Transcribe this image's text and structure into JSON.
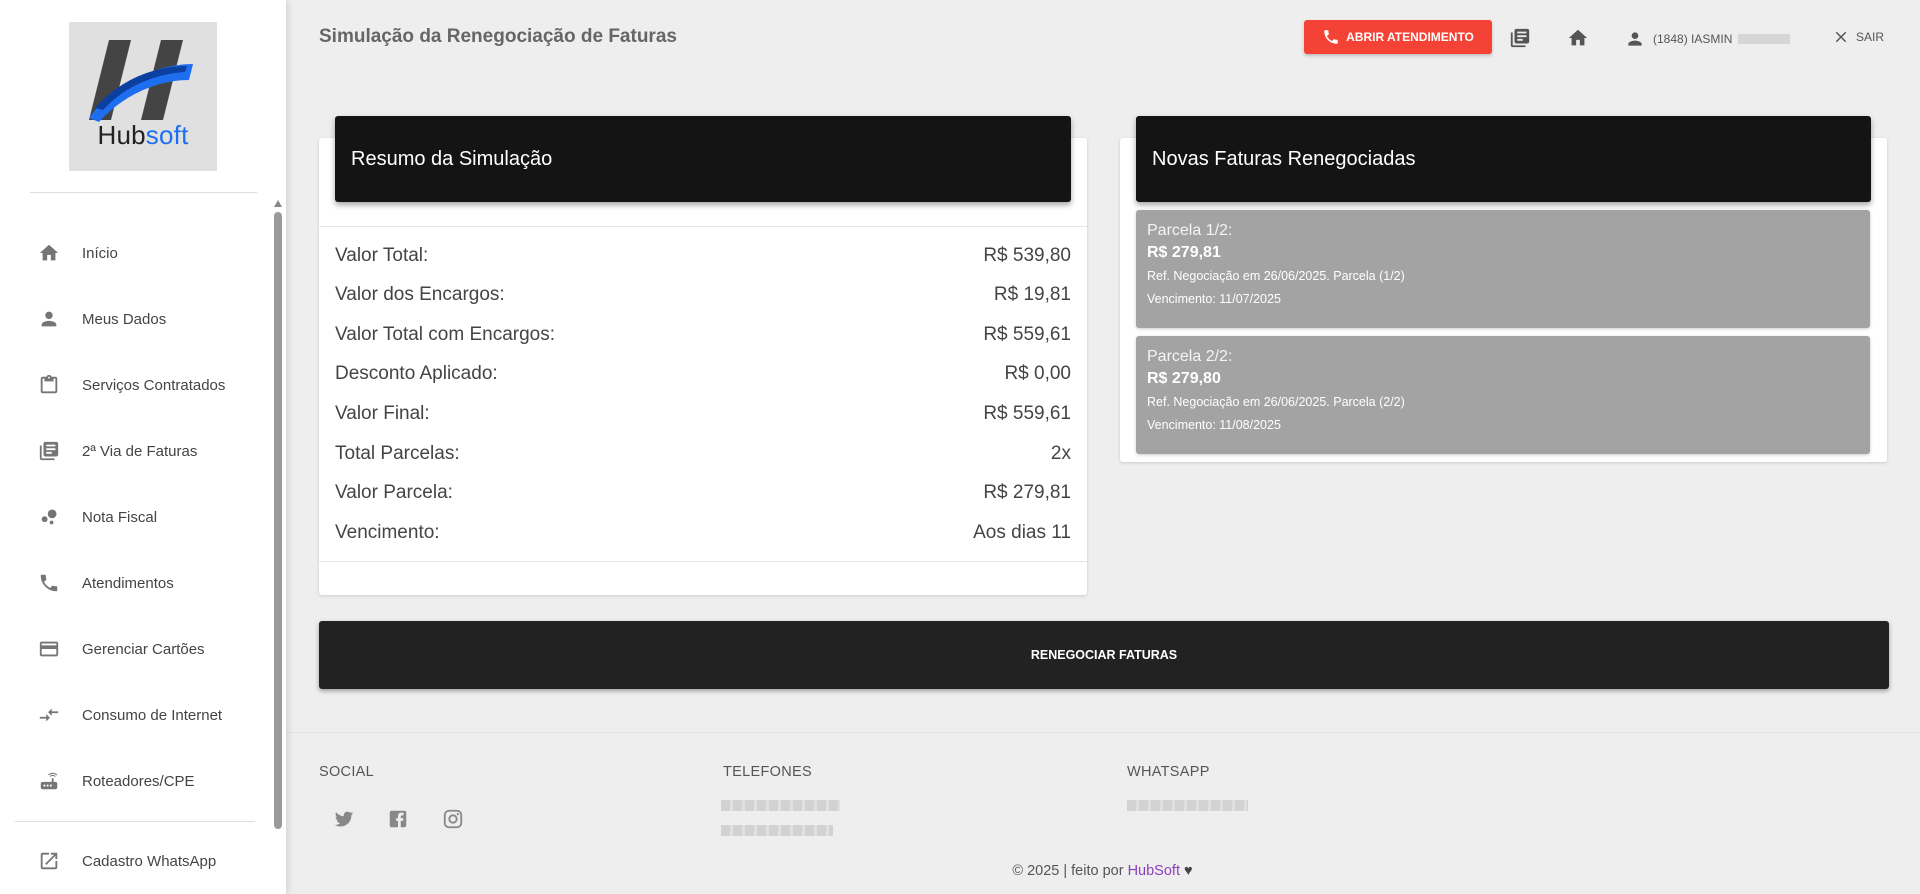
{
  "sidebar": {
    "logo_text_left": "Hub",
    "logo_text_right": "soft",
    "items": [
      {
        "label": "Início",
        "icon": "home-icon"
      },
      {
        "label": "Meus Dados",
        "icon": "person-icon"
      },
      {
        "label": "Serviços Contratados",
        "icon": "clipboard-icon"
      },
      {
        "label": "2ª Via de Faturas",
        "icon": "library-books-icon"
      },
      {
        "label": "Nota Fiscal",
        "icon": "bubble-chart-icon"
      },
      {
        "label": "Atendimentos",
        "icon": "phone-icon"
      },
      {
        "label": "Gerenciar Cartões",
        "icon": "credit-card-icon"
      },
      {
        "label": "Consumo de Internet",
        "icon": "compare-arrows-icon"
      },
      {
        "label": "Roteadores/CPE",
        "icon": "router-icon"
      },
      {
        "label": "Cadastro WhatsApp",
        "icon": "open-in-new-icon"
      }
    ]
  },
  "header": {
    "title": "Simulação da Renegociação de Faturas",
    "atendimento_label": "ABRIR ATENDIMENTO",
    "user_label": "(1848) IASMIN",
    "logout_label": "SAIR"
  },
  "summary": {
    "title": "Resumo da Simulação",
    "rows": [
      {
        "label": "Valor Total:",
        "value": "R$ 539,80"
      },
      {
        "label": "Valor dos Encargos:",
        "value": "R$ 19,81"
      },
      {
        "label": "Valor Total com Encargos:",
        "value": "R$ 559,61"
      },
      {
        "label": "Desconto Aplicado:",
        "value": "R$ 0,00"
      },
      {
        "label": "Valor Final:",
        "value": "R$ 559,61"
      },
      {
        "label": "Total Parcelas:",
        "value": "2x"
      },
      {
        "label": "Valor Parcela:",
        "value": "R$ 279,81"
      },
      {
        "label": "Vencimento:",
        "value": "Aos dias 11"
      }
    ]
  },
  "faturas": {
    "title": "Novas Faturas Renegociadas",
    "parcelas": [
      {
        "title": "Parcela 1/2:",
        "value": "R$ 279,81",
        "ref": "Ref. Negociação em 26/06/2025. Parcela (1/2)",
        "vencimento": "Vencimento: 11/07/2025"
      },
      {
        "title": "Parcela 2/2:",
        "value": "R$ 279,80",
        "ref": "Ref. Negociação em 26/06/2025. Parcela (2/2)",
        "vencimento": "Vencimento: 11/08/2025"
      }
    ]
  },
  "action": {
    "renegociar_label": "RENEGOCIAR FATURAS"
  },
  "footer": {
    "social_heading": "SOCIAL",
    "telefones_heading": "TELEFONES",
    "whatsapp_heading": "WHATSAPP",
    "copyright_prefix": "© 2025 | feito por",
    "brand": "HubSoft",
    "heart": "♥"
  },
  "colors": {
    "accent_red": "#f44336",
    "header_black": "#141414",
    "brand_blue": "#1e6ff0",
    "brand_purple": "#8e3fbf"
  }
}
